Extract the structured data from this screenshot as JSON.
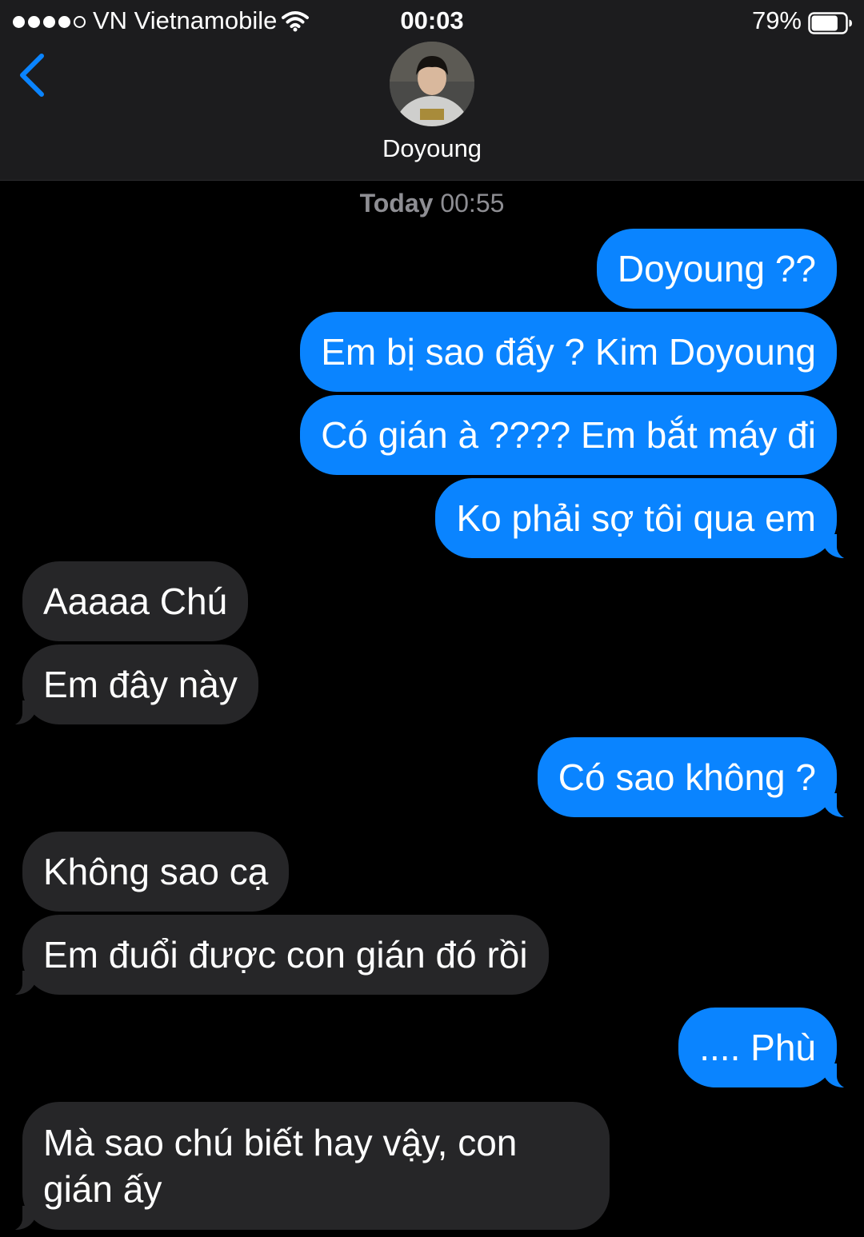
{
  "status_bar": {
    "carrier": "VN Vietnamobile",
    "time": "00:03",
    "battery": "79%",
    "battery_level": 0.79,
    "signal_bars_filled": 4,
    "signal_bars_total": 5
  },
  "header": {
    "contact_name": "Doyoung",
    "back_icon": "chevron-left-icon",
    "avatar_icon": "contact-avatar"
  },
  "conversation": {
    "timestamp_day": "Today",
    "timestamp_time": "00:55",
    "messages": [
      {
        "direction": "outgoing",
        "text": "Doyoung ??"
      },
      {
        "direction": "outgoing",
        "text": "Em bị sao đấy ? Kim Doyoung"
      },
      {
        "direction": "outgoing",
        "text": "Có gián à ???? Em bắt máy đi"
      },
      {
        "direction": "outgoing",
        "text": "Ko phải sợ tôi qua em"
      },
      {
        "direction": "incoming",
        "text": "Aaaaa Chú"
      },
      {
        "direction": "incoming",
        "text": "Em đây này"
      },
      {
        "direction": "outgoing",
        "text": "Có sao không ?"
      },
      {
        "direction": "incoming",
        "text": "Không sao cạ"
      },
      {
        "direction": "incoming",
        "text": "Em đuổi được con gián đó rồi"
      },
      {
        "direction": "outgoing",
        "text": ".... Phù"
      },
      {
        "direction": "incoming",
        "text": "Mà sao chú biết hay vậy, con gián ấy"
      }
    ]
  },
  "colors": {
    "outgoing_bubble": "#0a84ff",
    "incoming_bubble": "#262628",
    "header_background": "#1c1c1e",
    "accent": "#0a84ff"
  }
}
